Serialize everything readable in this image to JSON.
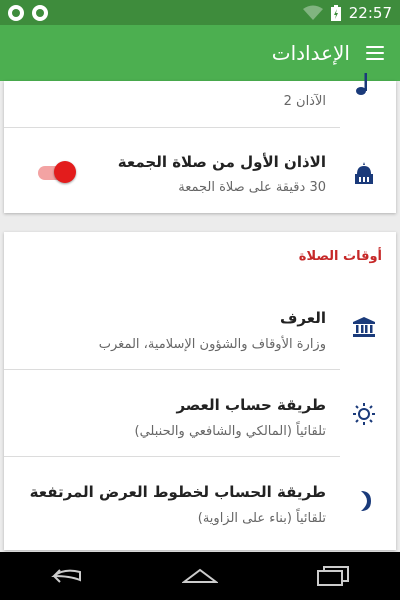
{
  "status_bar": {
    "time": "22:57",
    "icons": [
      "whatsapp-icon",
      "phone-icon",
      "wifi-icon",
      "battery-icon"
    ]
  },
  "app_bar": {
    "title": "الإعدادات",
    "menu_icon": "menu-icon"
  },
  "card1": {
    "rows": [
      {
        "title": "",
        "subtitle": "الآذان 2",
        "icon": "music-note-icon"
      },
      {
        "title": "الاذان الأول من صلاة الجمعة",
        "subtitle": "30 دقيقة على صلاة الجمعة",
        "icon": "mosque-icon",
        "toggle_on": true
      }
    ]
  },
  "card2": {
    "section_title": "أوقات الصلاة",
    "rows": [
      {
        "title": "العرف",
        "subtitle": "وزارة الأوقاف والشؤون الإسلامية، المغرب",
        "icon": "institution-icon"
      },
      {
        "title": "طريقة حساب العصر",
        "subtitle": "تلقائياً (المالكي والشافعي والحنبلي)",
        "icon": "sun-icon"
      },
      {
        "title": "طريقة الحساب لخطوط العرض المرتفعة",
        "subtitle": "تلقائياً (بناء على الزاوية)",
        "icon": "moon-icon"
      }
    ]
  },
  "colors": {
    "status_bar": "#3e8c3c",
    "app_bar": "#4caf50",
    "section_header": "#c62828",
    "toggle_thumb": "#e31c1c",
    "icon_blue": "#1a3a7a"
  },
  "nav_bar": {
    "buttons": [
      "back-button",
      "home-button",
      "recents-button"
    ]
  }
}
